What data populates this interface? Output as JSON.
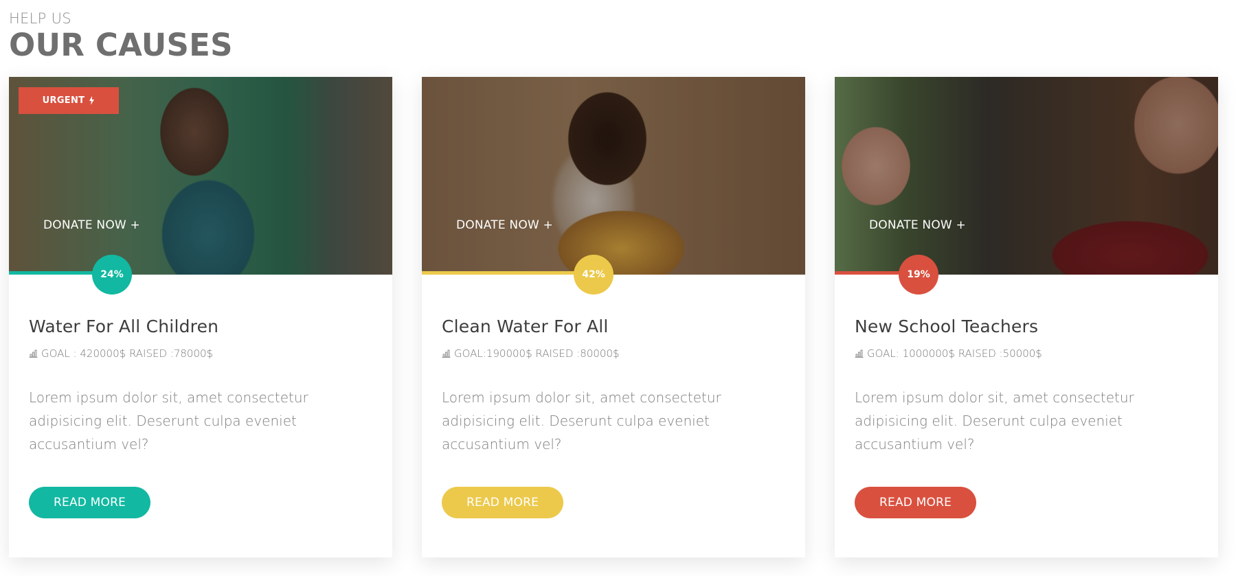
{
  "header": {
    "eyebrow": "HELP US",
    "title": "OUR CAUSES"
  },
  "causes": [
    {
      "badge": "URGENT",
      "badge_icon": "bolt-icon",
      "donate_label": "DONATE NOW +",
      "progress_percent": 24,
      "progress_label": "24%",
      "title": "Water For All Children",
      "goal_text": "GOAL : 420000$ RAISED :78000$",
      "description": "Lorem ipsum dolor sit, amet consectetur adipisicing elit. Deserunt culpa eveniet accusantium vel?",
      "button_label": "READ MORE",
      "accent": "#12b8a1"
    },
    {
      "badge": "",
      "donate_label": "DONATE NOW +",
      "progress_percent": 42,
      "progress_label": "42%",
      "title": "Clean Water For All",
      "goal_text": "GOAL:190000$ RAISED :80000$",
      "description": "Lorem ipsum dolor sit, amet consectetur adipisicing elit. Deserunt culpa eveniet accusantium vel?",
      "button_label": "READ MORE",
      "accent": "#ecc94b"
    },
    {
      "badge": "",
      "donate_label": "DONATE NOW +",
      "progress_percent": 19,
      "progress_label": "19%",
      "title": "New School Teachers",
      "goal_text": "GOAL: 1000000$ RAISED :50000$",
      "description": "Lorem ipsum dolor sit, amet consectetur adipisicing elit. Deserunt culpa eveniet accusantium vel?",
      "button_label": "READ MORE",
      "accent": "#d9503f"
    }
  ]
}
